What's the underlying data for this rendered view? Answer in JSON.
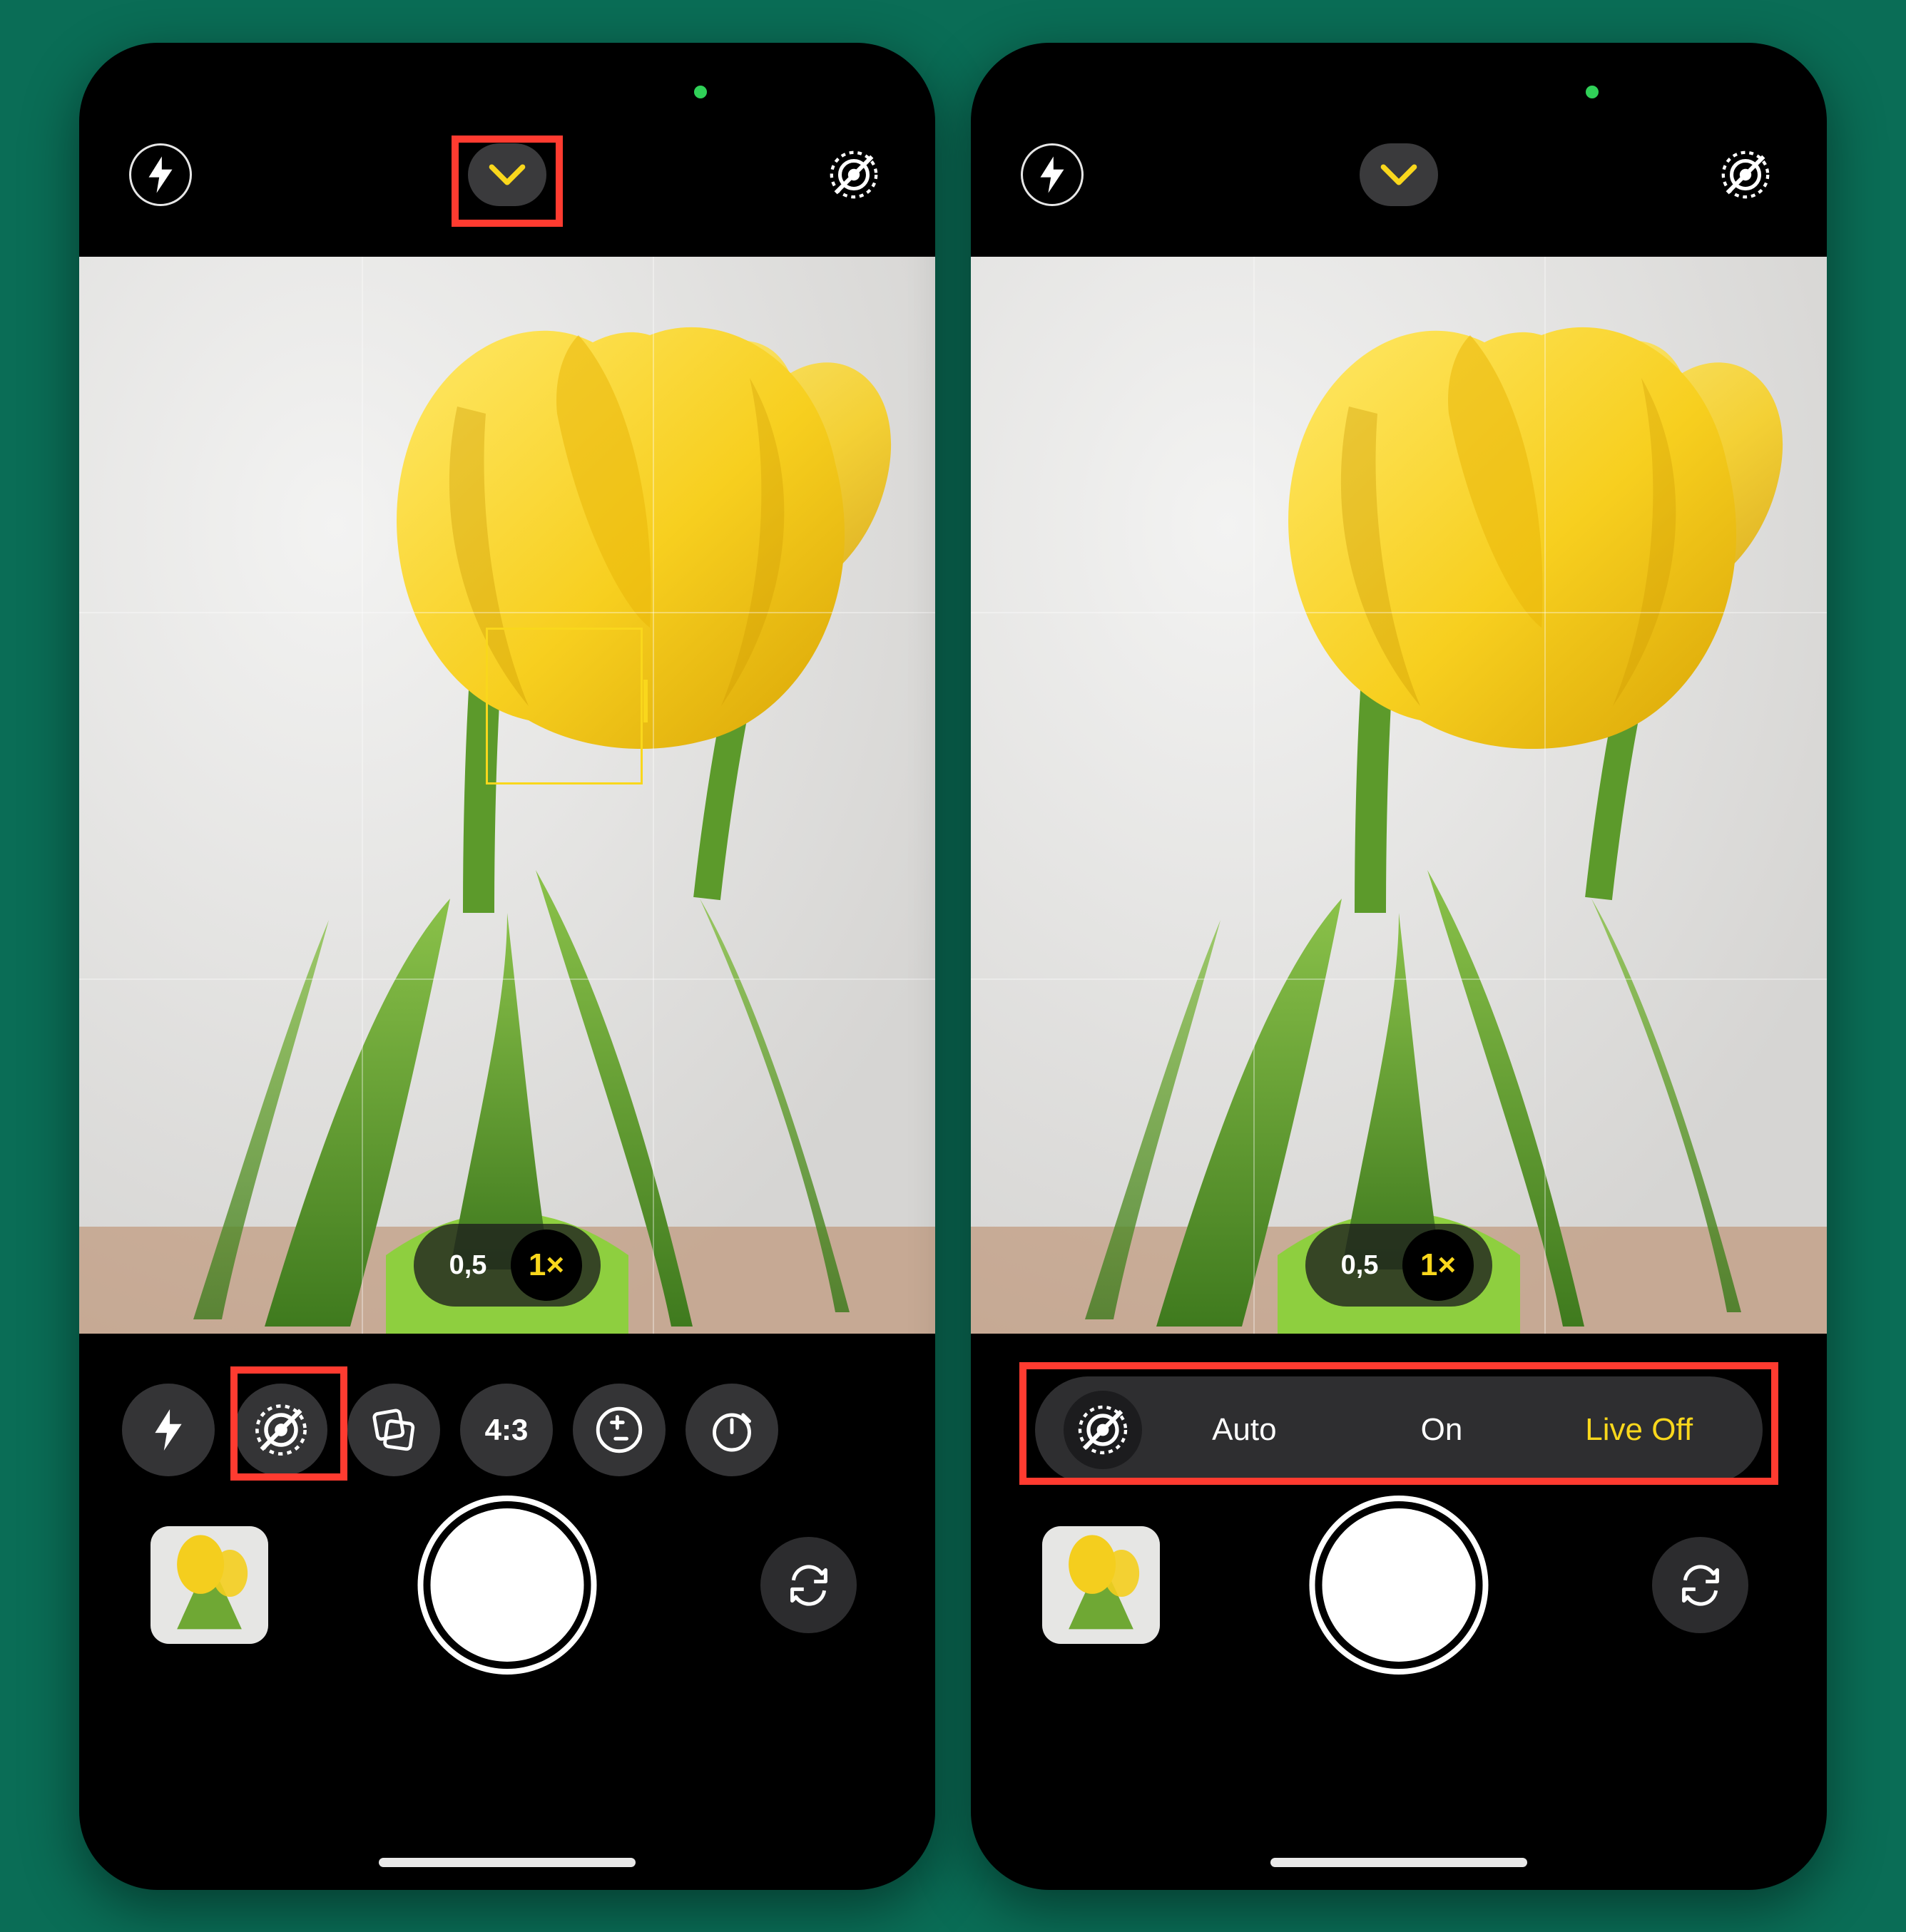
{
  "colors": {
    "accent": "#f9d71c",
    "highlight": "#ff3b30"
  },
  "viewfinder_subject": "yellow-tulips",
  "zoom": {
    "options": [
      "0,5",
      "1×"
    ],
    "selected_index": 1
  },
  "left": {
    "top_icons": {
      "flash": "flash-icon",
      "expand": "chevron-down-icon",
      "live": "live-photo-off-icon"
    },
    "tools": [
      {
        "name": "flash-button",
        "icon": "flash-icon",
        "label": ""
      },
      {
        "name": "live-photo-button",
        "icon": "live-photo-off-icon",
        "label": ""
      },
      {
        "name": "photographic-styles-button",
        "icon": "styles-icon",
        "label": ""
      },
      {
        "name": "aspect-ratio-button",
        "icon": "",
        "label": "4:3"
      },
      {
        "name": "exposure-button",
        "icon": "plus-minus-icon",
        "label": ""
      },
      {
        "name": "timer-button",
        "icon": "timer-icon",
        "label": ""
      }
    ],
    "highlights": [
      "chevron-toggle",
      "live-photo-tool"
    ]
  },
  "right": {
    "top_icons": {
      "flash": "flash-icon",
      "expand": "chevron-down-icon",
      "live": "live-photo-off-icon"
    },
    "live_options": {
      "items": [
        "Auto",
        "On",
        "Live Off"
      ],
      "selected_index": 2
    },
    "highlights": [
      "live-options-row"
    ]
  }
}
